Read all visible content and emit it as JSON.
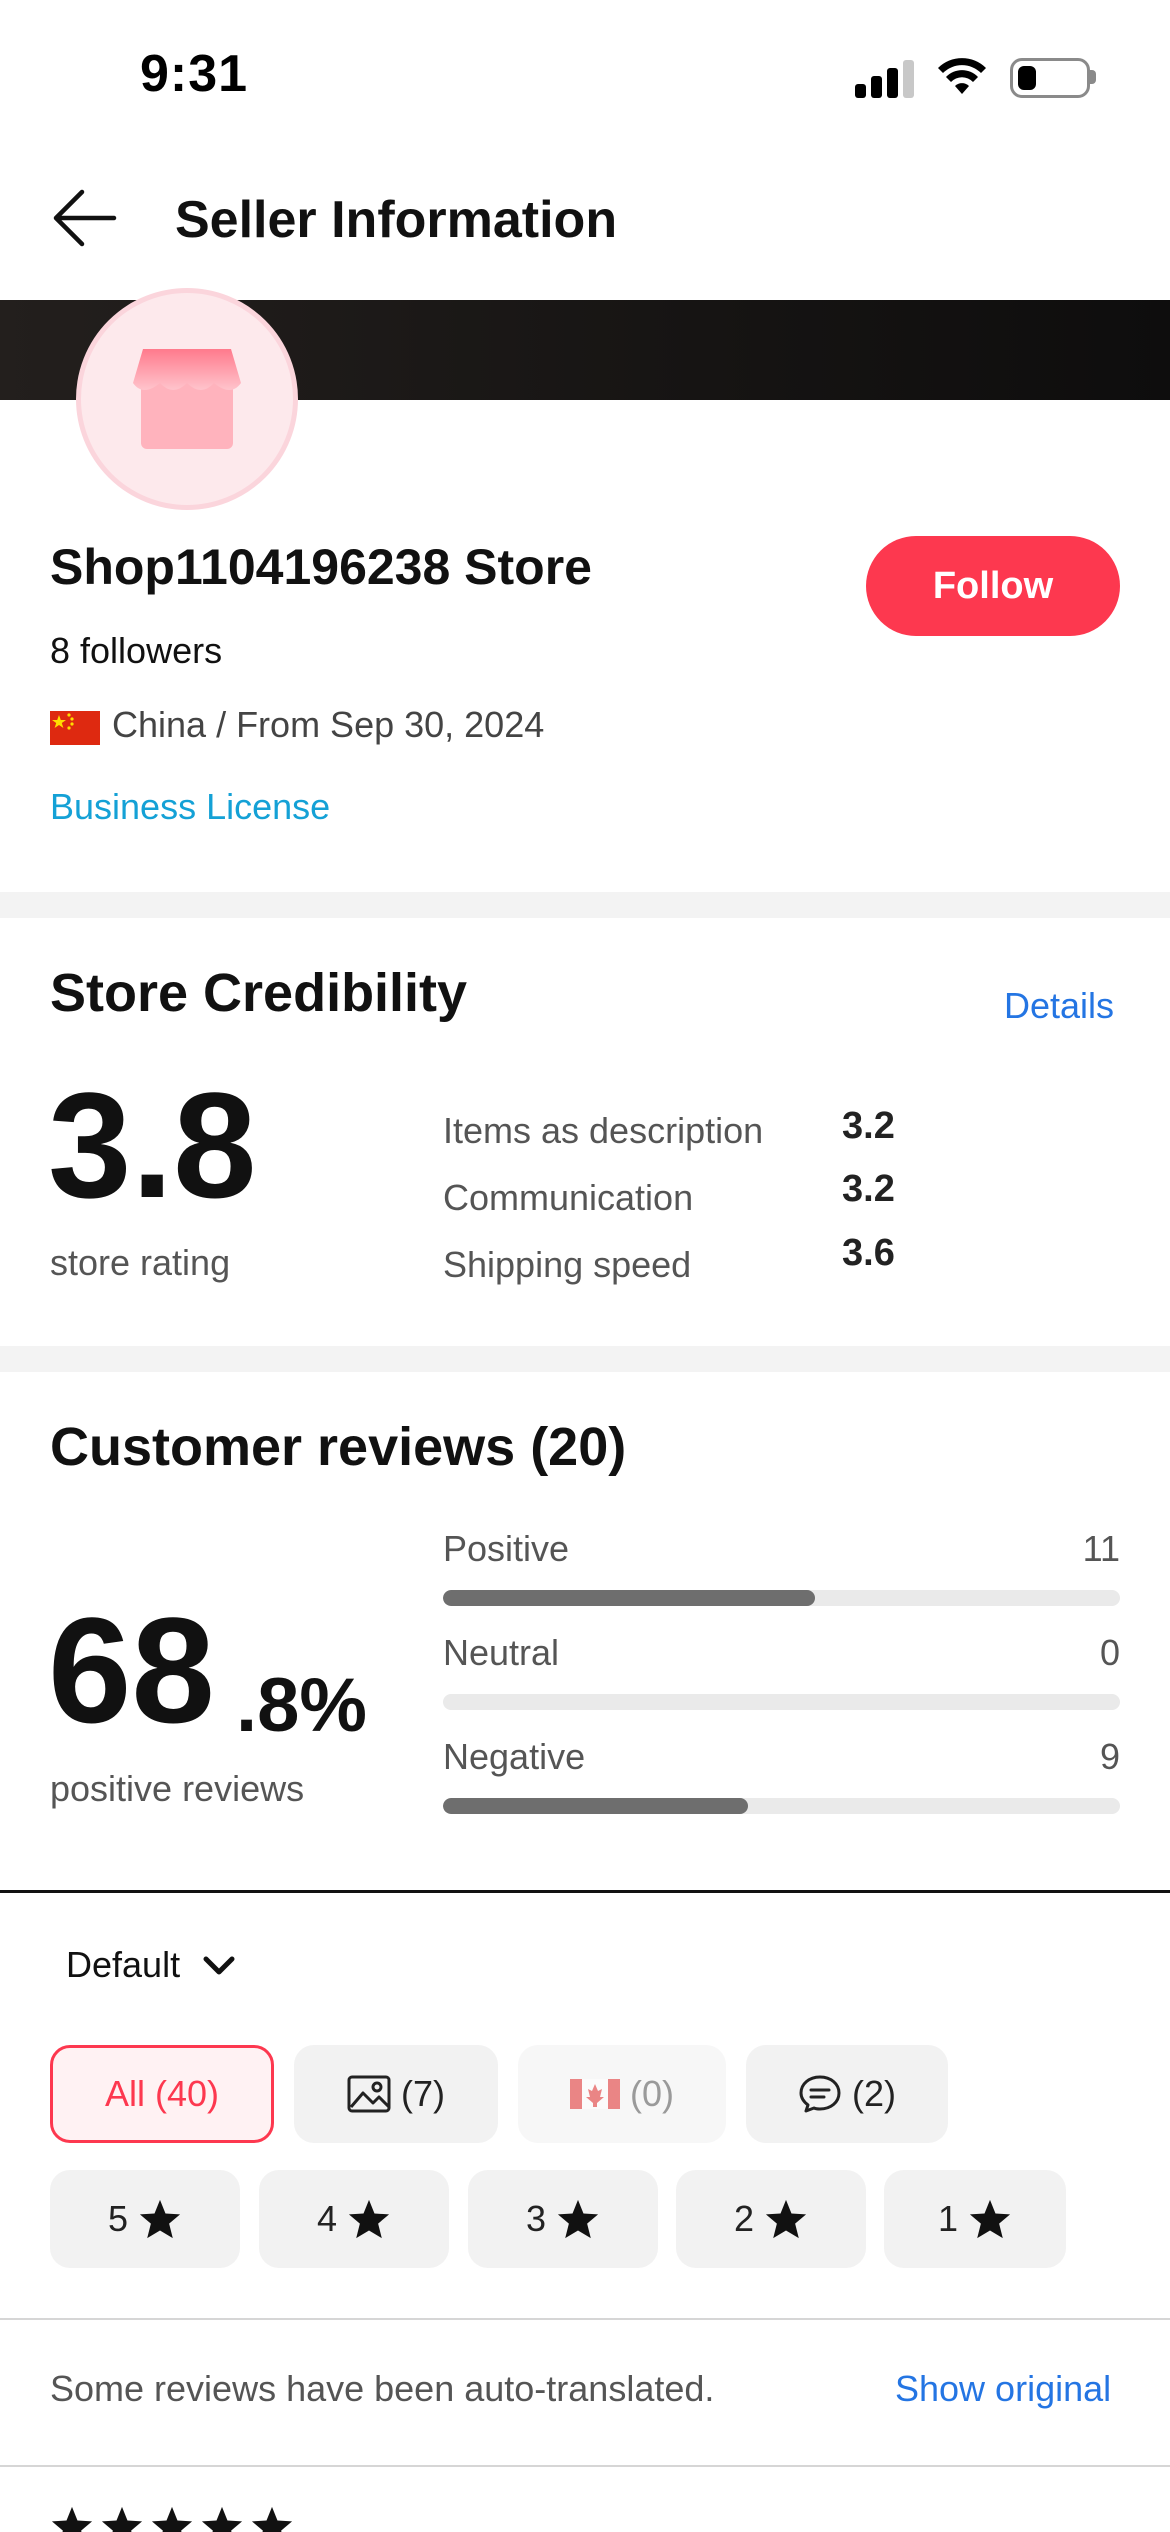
{
  "status_bar": {
    "time": "9:31"
  },
  "header": {
    "title": "Seller Information"
  },
  "store": {
    "name": "Shop1104196238 Store",
    "followers": "8 followers",
    "origin": "China / From Sep 30, 2024",
    "business_license": "Business License",
    "follow_label": "Follow"
  },
  "credibility": {
    "title": "Store Credibility",
    "details_label": "Details",
    "rating": "3.8",
    "rating_label": "store rating",
    "metrics": [
      {
        "label": "Items as description",
        "value": "3.2"
      },
      {
        "label": "Communication",
        "value": "3.2"
      },
      {
        "label": "Shipping speed",
        "value": "3.6"
      }
    ]
  },
  "reviews": {
    "title": "Customer reviews (20)",
    "percent_int": "68",
    "percent_dec": ".8%",
    "percent_label": "positive reviews",
    "breakdown": [
      {
        "label": "Positive",
        "count": "11",
        "fraction": 0.55
      },
      {
        "label": "Neutral",
        "count": "0",
        "fraction": 0
      },
      {
        "label": "Negative",
        "count": "9",
        "fraction": 0.45
      }
    ]
  },
  "filters": {
    "sort_label": "Default",
    "chips": [
      {
        "label": "All (40)"
      },
      {
        "label": "(7)"
      },
      {
        "label": "(0)"
      },
      {
        "label": "(2)"
      }
    ],
    "star_chips": [
      {
        "label": "5"
      },
      {
        "label": "4"
      },
      {
        "label": "3"
      },
      {
        "label": "2"
      },
      {
        "label": "1"
      }
    ]
  },
  "translation_notice": {
    "text": "Some reviews have been auto-translated.",
    "action": "Show original"
  },
  "colors": {
    "accent": "#fd384f",
    "link_blue": "#2475e3",
    "license_blue": "#14a1d6",
    "bar_fill": "#6e6e6e"
  },
  "icons": [
    "signal-icon",
    "wifi-icon",
    "battery-icon",
    "back-arrow-icon",
    "store-icon",
    "china-flag-icon",
    "image-icon",
    "canada-flag-icon",
    "comment-icon",
    "star-icon",
    "chevron-down-icon"
  ]
}
